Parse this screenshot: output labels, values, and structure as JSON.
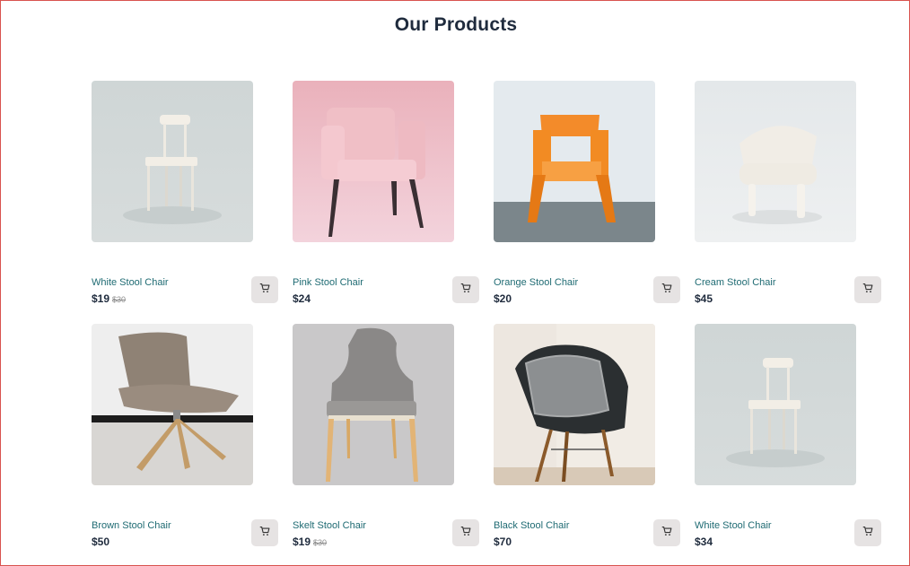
{
  "page": {
    "title": "Our Products"
  },
  "products": [
    {
      "name": "White Stool Chair",
      "price": "$19",
      "old_price": "$30",
      "image": "white-bentwood-chair"
    },
    {
      "name": "Pink Stool Chair",
      "price": "$24",
      "old_price": "",
      "image": "pink-armchair"
    },
    {
      "name": "Orange Stool Chair",
      "price": "$20",
      "old_price": "",
      "image": "orange-plastic-chair"
    },
    {
      "name": "Cream Stool Chair",
      "price": "$45",
      "old_price": "",
      "image": "cream-tufted-chair"
    },
    {
      "name": "Brown Stool Chair",
      "price": "$50",
      "old_price": "",
      "image": "brown-lounge-chair"
    },
    {
      "name": "Skelt Stool Chair",
      "price": "$19",
      "old_price": "$30",
      "image": "grey-wingback-chair"
    },
    {
      "name": "Black Stool Chair",
      "price": "$70",
      "old_price": "",
      "image": "black-shell-chair"
    },
    {
      "name": "White Stool Chair",
      "price": "$34",
      "old_price": "",
      "image": "white-bentwood-chair"
    }
  ],
  "icons": {
    "cart": "cart-icon"
  },
  "colors": {
    "title": "#1f2b3d",
    "product_name": "#1f6b73",
    "cart_button": "#e6e3e3"
  }
}
